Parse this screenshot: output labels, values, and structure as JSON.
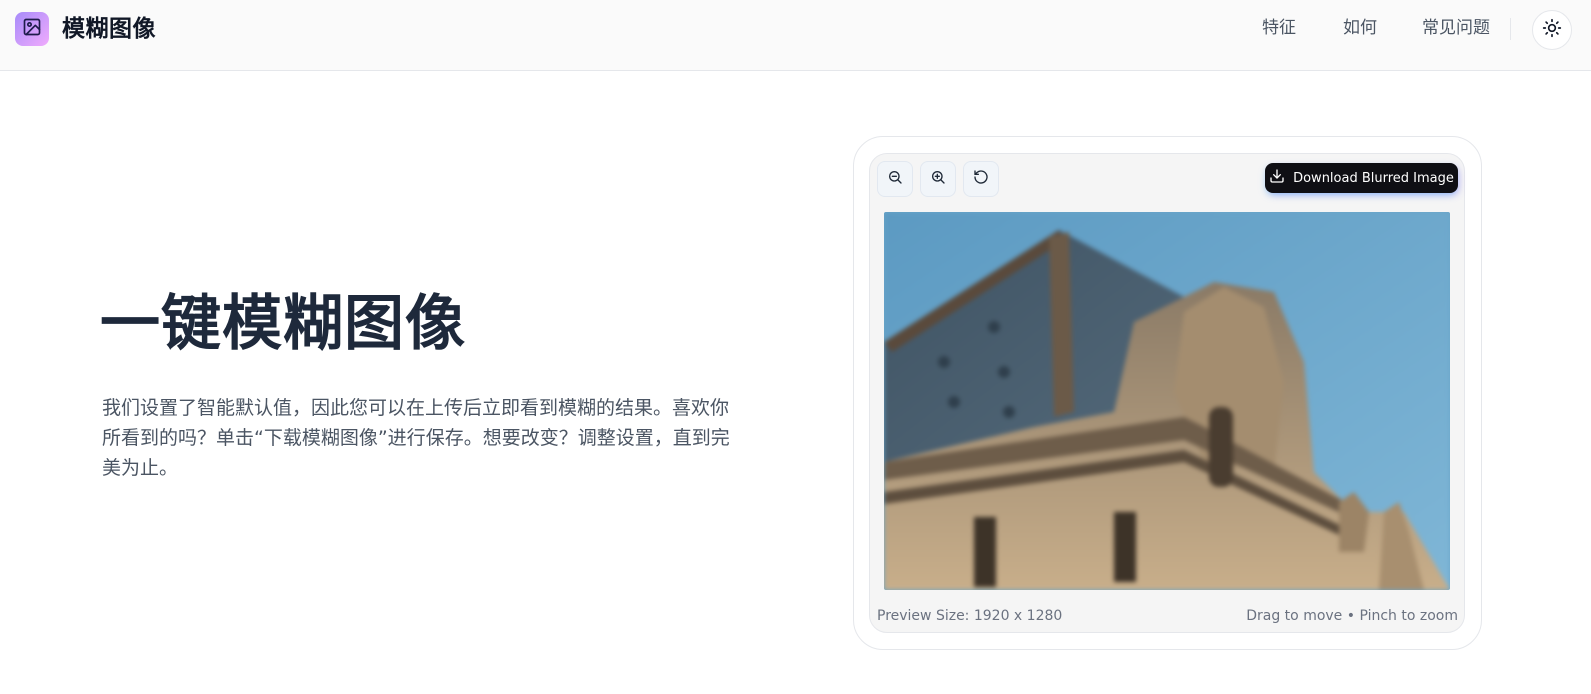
{
  "header": {
    "brand": "模糊图像",
    "nav": [
      "特征",
      "如何",
      "常见问题"
    ],
    "logo_icon": "image-icon",
    "theme_icon": "sun-icon"
  },
  "hero": {
    "title": "一键模糊图像",
    "description": "我们设置了智能默认值，因此您可以在上传后立即看到模糊的结果。喜欢你所看到的吗？单击“下载模糊图像”进行保存。想要改变？调整设置，直到完美为止。"
  },
  "preview": {
    "toolbar": {
      "zoom_out_icon": "zoom-out-icon",
      "zoom_in_icon": "zoom-in-icon",
      "reset_icon": "rotate-ccw-icon"
    },
    "download_label": "Download Blurred Image",
    "download_icon": "download-icon",
    "size_text": "Preview Size: 1920 x 1280",
    "hint_text": "Drag to move • Pinch to zoom"
  },
  "colors": {
    "accent_gradient_start": "#a78bfa",
    "accent_gradient_end": "#f0abfc",
    "button_dark": "#0f0f14",
    "heading": "#1e293b",
    "body_text": "#4b5563"
  }
}
